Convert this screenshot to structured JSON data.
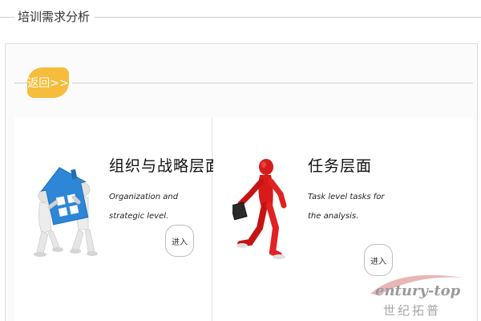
{
  "header": {
    "title": "培训需求分析"
  },
  "back": {
    "label": "返回>>"
  },
  "cards": [
    {
      "title": "组织与战略层面",
      "description": "Organization and strategic level.",
      "enter_label": "进入"
    },
    {
      "title": "任务层面",
      "description": "Task level tasks for the analysis.",
      "enter_label": "进入"
    }
  ],
  "watermark": {
    "en": "entury-top",
    "cn": "世纪拓普"
  },
  "colors": {
    "accent": "#f5bd3b",
    "house": "#2e86d6",
    "figure": "#d71a1a"
  },
  "icons": [
    "house-carrying-figures-icon",
    "running-businessman-icon"
  ]
}
